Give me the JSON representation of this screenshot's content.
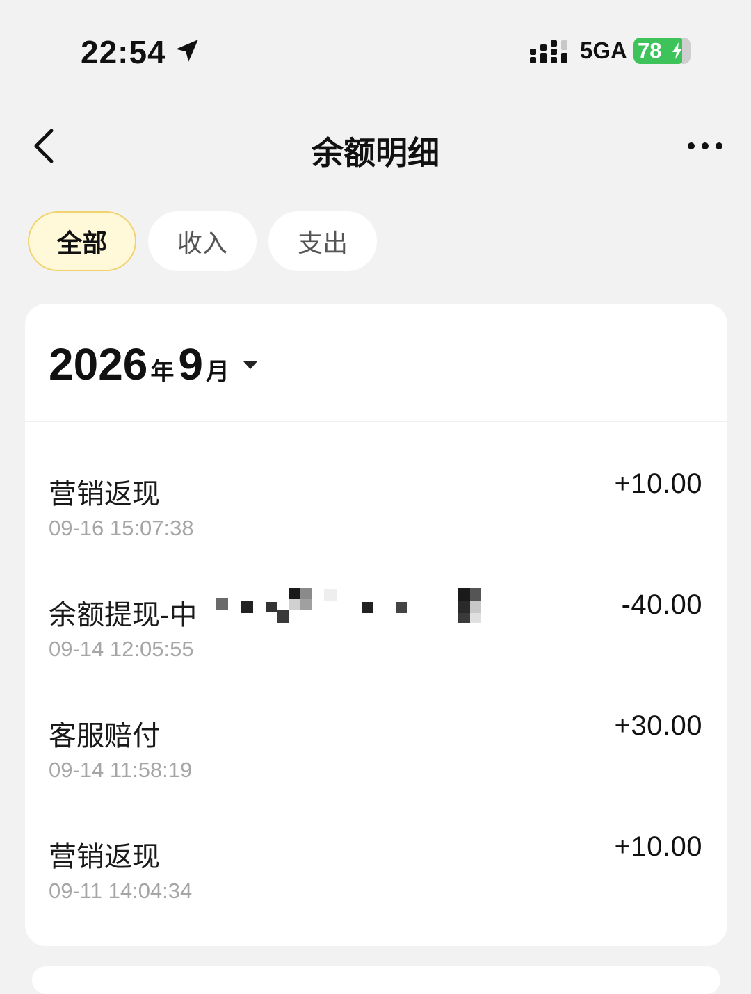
{
  "status_bar": {
    "time": "22:54",
    "network": "5GA",
    "battery": "78",
    "battery_color": "#3dc35a"
  },
  "nav": {
    "title": "余额明细",
    "back_icon": "chevron-left-icon",
    "more_icon": "more-horizontal-icon"
  },
  "filters": [
    {
      "label": "全部",
      "active": true
    },
    {
      "label": "收入",
      "active": false
    },
    {
      "label": "支出",
      "active": false
    }
  ],
  "month_picker": {
    "year": "2026",
    "year_suffix": "年",
    "month": "9",
    "month_suffix": "月"
  },
  "transactions": [
    {
      "title": "营销返现",
      "time": "09-16 15:07:38",
      "amount": "+10.00"
    },
    {
      "title": "余额提现-中",
      "time": "09-14 12:05:55",
      "amount": "-40.00"
    },
    {
      "title": "客服赔付",
      "time": "09-14 11:58:19",
      "amount": "+30.00"
    },
    {
      "title": "营销返现",
      "time": "09-11 14:04:34",
      "amount": "+10.00"
    }
  ],
  "colors": {
    "page_bg": "#f2f2f2",
    "active_tab_bg": "#fff8d9",
    "active_tab_border": "#f1d26c",
    "secondary_text": "#a6a6a6"
  }
}
